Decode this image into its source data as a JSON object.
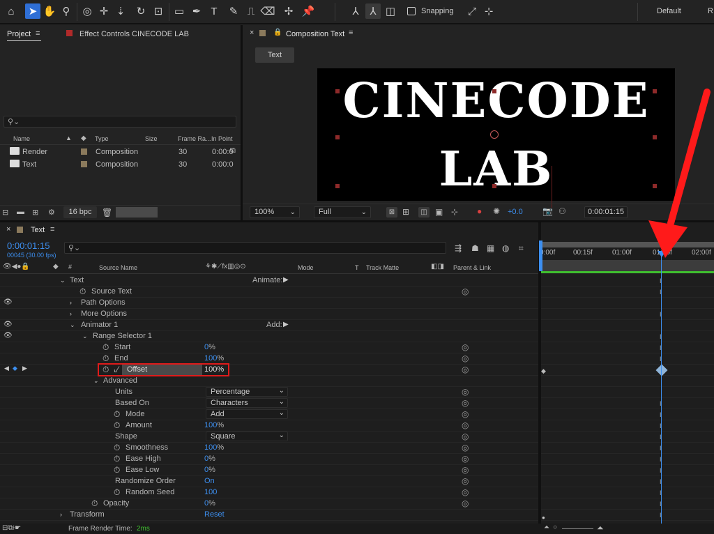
{
  "toolbar": {
    "snapping_label": "Snapping",
    "workspace_default": "Default",
    "workspace_next": "R"
  },
  "project_panel": {
    "tab_project": "Project",
    "tab_effect_controls": "Effect Controls CINECODE LAB",
    "columns": [
      "Name",
      "Type",
      "Size",
      "Frame Ra...",
      "In Point"
    ],
    "items": [
      {
        "name": "Render",
        "type": "Composition",
        "frame_rate": "30",
        "in_point": "0:00:0"
      },
      {
        "name": "Text",
        "type": "Composition",
        "frame_rate": "30",
        "in_point": "0:00:0"
      }
    ],
    "bit_depth": "16 bpc"
  },
  "comp_panel": {
    "tab_title": "Composition Text",
    "sub_tab": "Text",
    "canvas_line1": "CINECODE",
    "canvas_line2": "LAB",
    "zoom": "100%",
    "resolution": "Full",
    "exposure": "+0.0",
    "timecode": "0:00:01:15"
  },
  "timeline": {
    "tab_title": "Text",
    "timecode": "0:00:01:15",
    "frames_info": "00045 (30.00 fps)",
    "col_num": "#",
    "col_source": "Source Name",
    "col_mode": "Mode",
    "col_t": "T",
    "col_track_matte": "Track Matte",
    "col_parent": "Parent & Link",
    "ruler": [
      "0:00f",
      "00:15f",
      "01:00f",
      "01:15f",
      "02:00f"
    ],
    "layer_name": "Text",
    "animate_label": "Animate:",
    "source_text": "Source Text",
    "path_options": "Path Options",
    "more_options": "More Options",
    "animator": "Animator 1",
    "add_label": "Add:",
    "range_selector": "Range Selector 1",
    "start": {
      "label": "Start",
      "value": "0",
      "unit": "%"
    },
    "end": {
      "label": "End",
      "value": "100",
      "unit": "%"
    },
    "offset": {
      "label": "Offset",
      "value": "100%"
    },
    "advanced": "Advanced",
    "units": {
      "label": "Units",
      "value": "Percentage"
    },
    "based_on": {
      "label": "Based On",
      "value": "Characters"
    },
    "mode": {
      "label": "Mode",
      "value": "Add"
    },
    "amount": {
      "label": "Amount",
      "value": "100",
      "unit": "%"
    },
    "shape": {
      "label": "Shape",
      "value": "Square"
    },
    "smoothness": {
      "label": "Smoothness",
      "value": "100",
      "unit": "%"
    },
    "ease_high": {
      "label": "Ease High",
      "value": "0",
      "unit": "%"
    },
    "ease_low": {
      "label": "Ease Low",
      "value": "0",
      "unit": "%"
    },
    "randomize": {
      "label": "Randomize Order",
      "value": "On"
    },
    "random_seed": {
      "label": "Random Seed",
      "value": "100"
    },
    "opacity": {
      "label": "Opacity",
      "value": "0",
      "unit": "%"
    },
    "transform": {
      "label": "Transform",
      "value": "Reset"
    }
  },
  "status": {
    "render_label": "Frame Render Time:",
    "render_value": "2ms"
  },
  "colors": {
    "accent_blue": "#3d8ff0",
    "highlight_red": "#e01b1b",
    "arrow_red": "#ff1a1a",
    "green_bar": "#3fbf2f"
  }
}
